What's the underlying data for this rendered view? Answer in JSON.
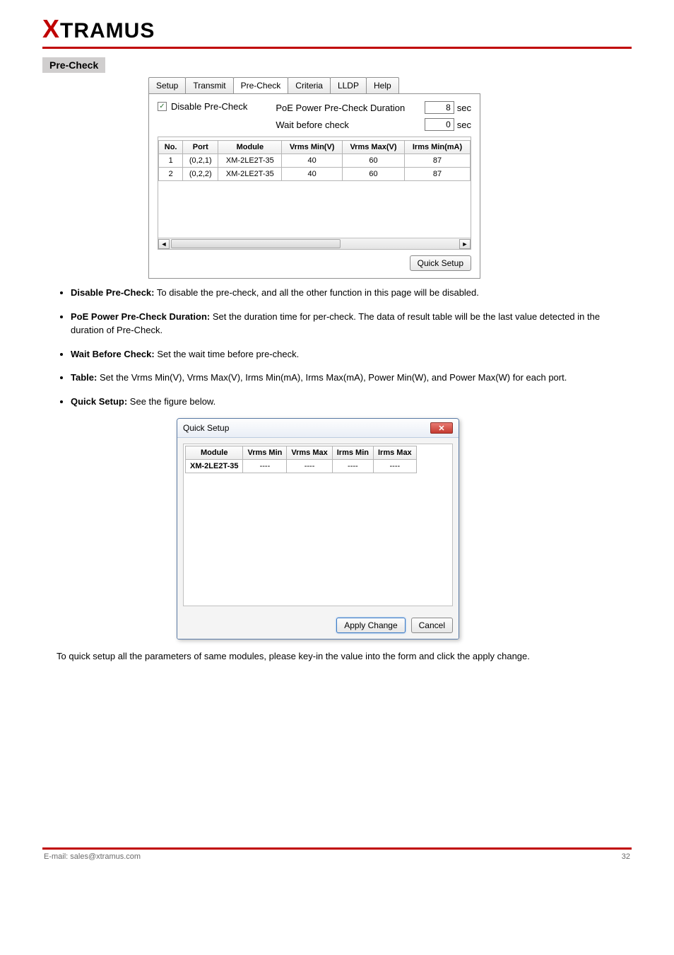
{
  "logo": {
    "x": "X",
    "rest": "TRAMUS"
  },
  "section_title": "Pre-Check",
  "tabs": [
    "Setup",
    "Transmit",
    "Pre-Check",
    "Criteria",
    "LLDP",
    "Help"
  ],
  "active_tab_index": 2,
  "checkbox": {
    "checked": true,
    "label": "Disable Pre-Check"
  },
  "duration_label": "PoE Power Pre-Check Duration",
  "wait_label": "Wait before check",
  "duration_value": "8",
  "wait_value": "0",
  "sec": "sec",
  "table": {
    "headers": [
      "No.",
      "Port",
      "Module",
      "Vrms Min(V)",
      "Vrms Max(V)",
      "Irms Min(mA)"
    ],
    "rows": [
      [
        "1",
        "(0,2,1)",
        "XM-2LE2T-35",
        "40",
        "60",
        "87"
      ],
      [
        "2",
        "(0,2,2)",
        "XM-2LE2T-35",
        "40",
        "60",
        "87"
      ]
    ]
  },
  "quick_setup_btn": "Quick Setup",
  "bullets": [
    {
      "strong": "Disable Pre-Check:",
      "text": " To disable the pre-check, and all the other function in this page will be disabled."
    },
    {
      "strong": "PoE Power Pre-Check Duration:",
      "text": " Set the duration time for per-check. The data of result table will be the last value detected in the duration of Pre-Check."
    },
    {
      "strong": "Wait Before Check:",
      "text": " Set the wait time before pre-check."
    },
    {
      "strong": "Table:",
      "text": " Set the Vrms Min(V), Vrms Max(V), Irms Min(mA), Irms Max(mA), Power Min(W), and Power Max(W) for each port."
    },
    {
      "strong": "Quick Setup:",
      "text": " See the figure below."
    }
  ],
  "dialog": {
    "title": "Quick Setup",
    "headers": [
      "Module",
      "Vrms Min",
      "Vrms Max",
      "Irms Min",
      "Irms Max"
    ],
    "row": [
      "XM-2LE2T-35",
      "----",
      "----",
      "----",
      "----"
    ],
    "apply": "Apply Change",
    "cancel": "Cancel"
  },
  "after_dialog": "To quick setup all the parameters of same modules, please key-in the value into the form and click the apply change.",
  "footer": {
    "left": "E-mail: sales@xtramus.com",
    "right": "32"
  }
}
